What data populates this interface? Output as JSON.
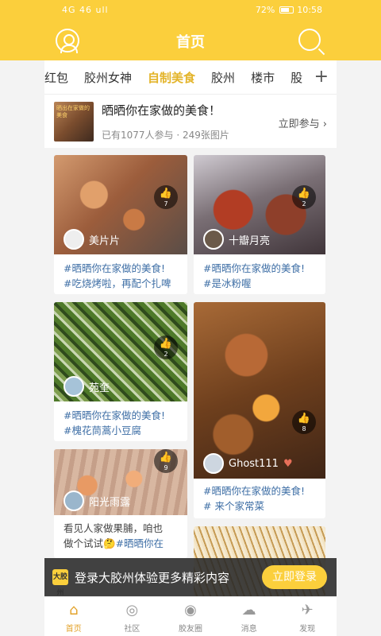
{
  "status_bar": {
    "left": "4G 46 ull",
    "battery": "72%",
    "time": "10:58"
  },
  "header": {
    "title": "首页"
  },
  "tabs": [
    "红包",
    "胶州女神",
    "自制美食",
    "胶州",
    "楼市",
    "股"
  ],
  "active_tab": "自制美食",
  "banner": {
    "thumb_text": "晒出在家做的美食",
    "title": "晒晒你在家做的美食！",
    "subtitle": "已有1077人参与 · 249张图片",
    "join": "立即参与 ›"
  },
  "posts": [
    {
      "user": "美片片",
      "likes": "7",
      "text_tag": "#晒晒你在家做的美食!",
      "text_line2": "#吃烧烤啦，再配个扎啤"
    },
    {
      "user": "十瓣月亮",
      "likes": "2",
      "text_tag": "#晒晒你在家做的美食!",
      "text_line2": "#是冰粉喔"
    },
    {
      "user": "苑奎",
      "likes": "2",
      "text_tag": "#晒晒你在家做的美食!",
      "text_line2": "#槐花茼蒿小豆腐"
    },
    {
      "user": "Ghost111",
      "likes": "8",
      "text_tag": "#晒晒你在家做的美食!",
      "text_line2": "# 来个家常菜"
    },
    {
      "user": "阳光雨露",
      "likes": "9",
      "text_pre": "看见人家做果脯，咱也",
      "text_pre2": "做个试试🤔",
      "text_tag": "#晒晒你在"
    }
  ],
  "login_bar": {
    "logo": "大胶州",
    "message": "登录大胶州体验更多精彩内容",
    "button": "立即登录"
  },
  "bottom_nav": [
    "首页",
    "社区",
    "胶友圈",
    "消息",
    "发现"
  ],
  "colors": {
    "brand": "#fbcf3c",
    "tag": "#3f6fa6",
    "active": "#e3a22a"
  }
}
